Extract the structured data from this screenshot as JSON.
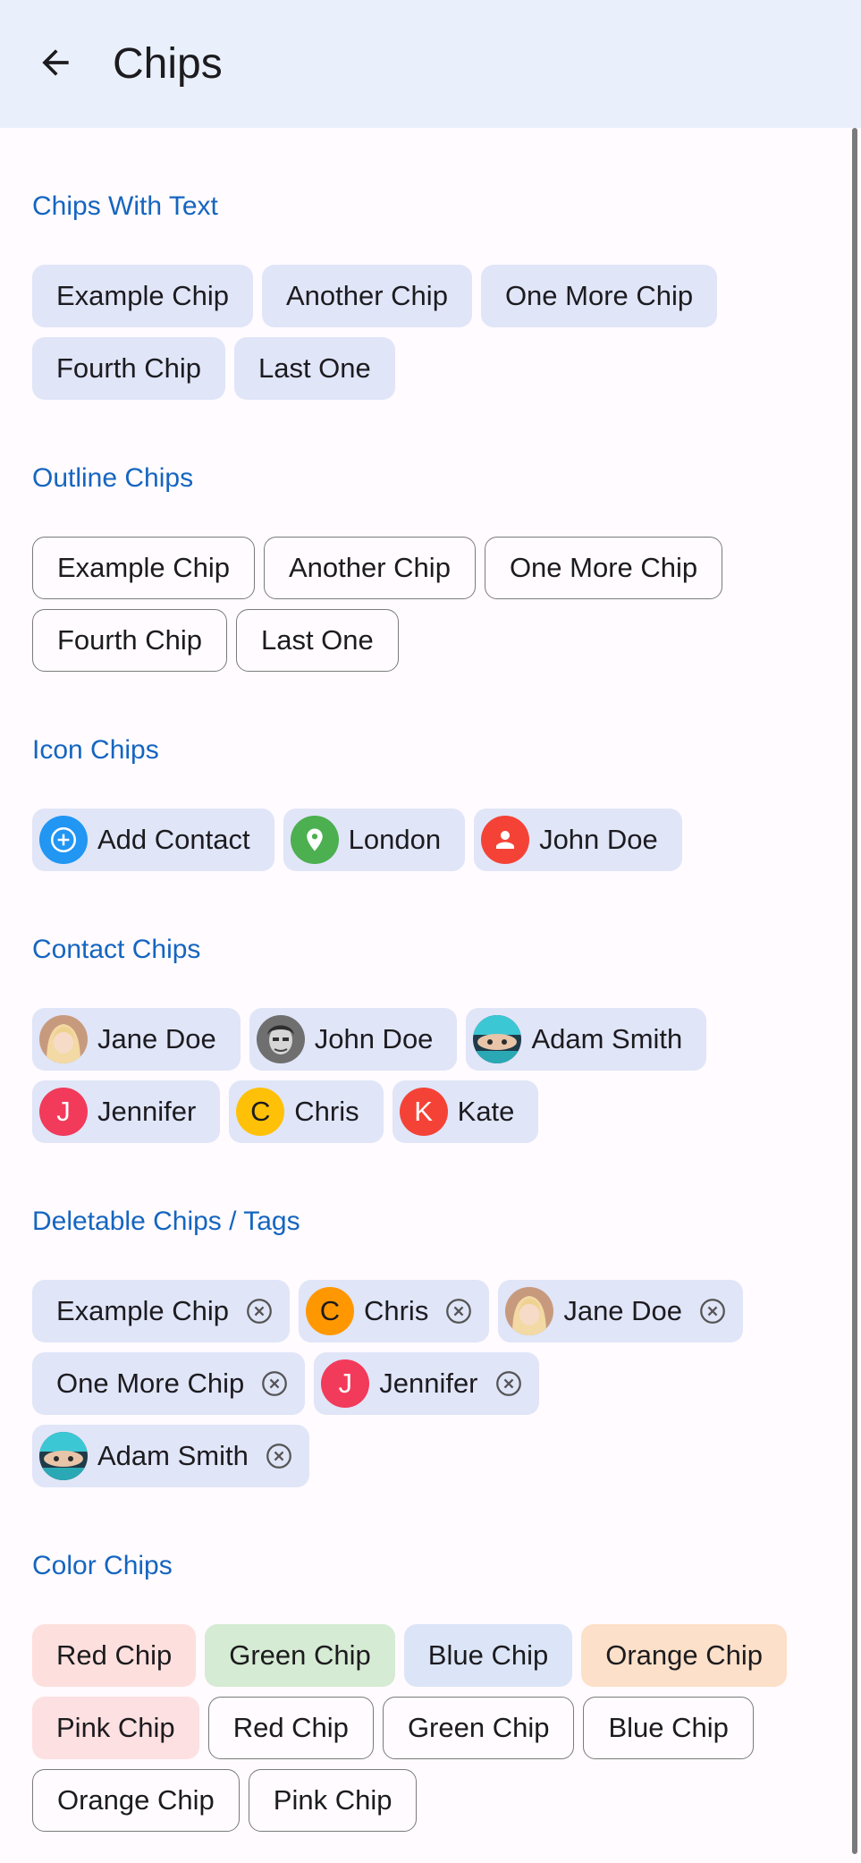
{
  "appbar": {
    "title": "Chips"
  },
  "text_chips": {
    "title": "Chips With Text",
    "items": [
      "Example Chip",
      "Another Chip",
      "One More Chip",
      "Fourth Chip",
      "Last One"
    ]
  },
  "outline_chips": {
    "title": "Outline Chips",
    "items": [
      "Example Chip",
      "Another Chip",
      "One More Chip",
      "Fourth Chip",
      "Last One"
    ]
  },
  "icon_chips": {
    "title": "Icon Chips",
    "items": [
      {
        "label": "Add Contact",
        "icon": "add-icon",
        "color": "#2196f3"
      },
      {
        "label": "London",
        "icon": "location-pin-icon",
        "color": "#4caf50"
      },
      {
        "label": "John Doe",
        "icon": "person-icon",
        "color": "#f44336"
      }
    ]
  },
  "contact_chips": {
    "title": "Contact Chips",
    "items": [
      {
        "label": "Jane Doe",
        "avatar": "photo-jane"
      },
      {
        "label": "John Doe",
        "avatar": "photo-john"
      },
      {
        "label": "Adam Smith",
        "avatar": "photo-adam"
      },
      {
        "label": "Jennifer",
        "initial": "J",
        "color": "#f23a5a"
      },
      {
        "label": "Chris",
        "initial": "C",
        "color": "#ffc107"
      },
      {
        "label": "Kate",
        "initial": "K",
        "color": "#f44336"
      }
    ]
  },
  "deletable_chips": {
    "title": "Deletable Chips / Tags",
    "items": [
      {
        "label": "Example Chip"
      },
      {
        "label": "Chris",
        "initial": "C",
        "color": "#ff9800"
      },
      {
        "label": "Jane Doe",
        "avatar": "photo-jane"
      },
      {
        "label": "One More Chip"
      },
      {
        "label": "Jennifer",
        "initial": "J",
        "color": "#f23a5a"
      },
      {
        "label": "Adam Smith",
        "avatar": "photo-adam"
      }
    ]
  },
  "color_chips": {
    "title": "Color Chips",
    "items": [
      {
        "label": "Red Chip",
        "style": "filled",
        "color": "red"
      },
      {
        "label": "Green Chip",
        "style": "filled",
        "color": "green"
      },
      {
        "label": "Blue Chip",
        "style": "filled",
        "color": "blue"
      },
      {
        "label": "Orange Chip",
        "style": "filled",
        "color": "orange"
      },
      {
        "label": "Pink Chip",
        "style": "filled",
        "color": "pink"
      },
      {
        "label": "Red Chip",
        "style": "outline"
      },
      {
        "label": "Green Chip",
        "style": "outline"
      },
      {
        "label": "Blue Chip",
        "style": "outline"
      },
      {
        "label": "Orange Chip",
        "style": "outline"
      },
      {
        "label": "Pink Chip",
        "style": "outline"
      }
    ]
  }
}
